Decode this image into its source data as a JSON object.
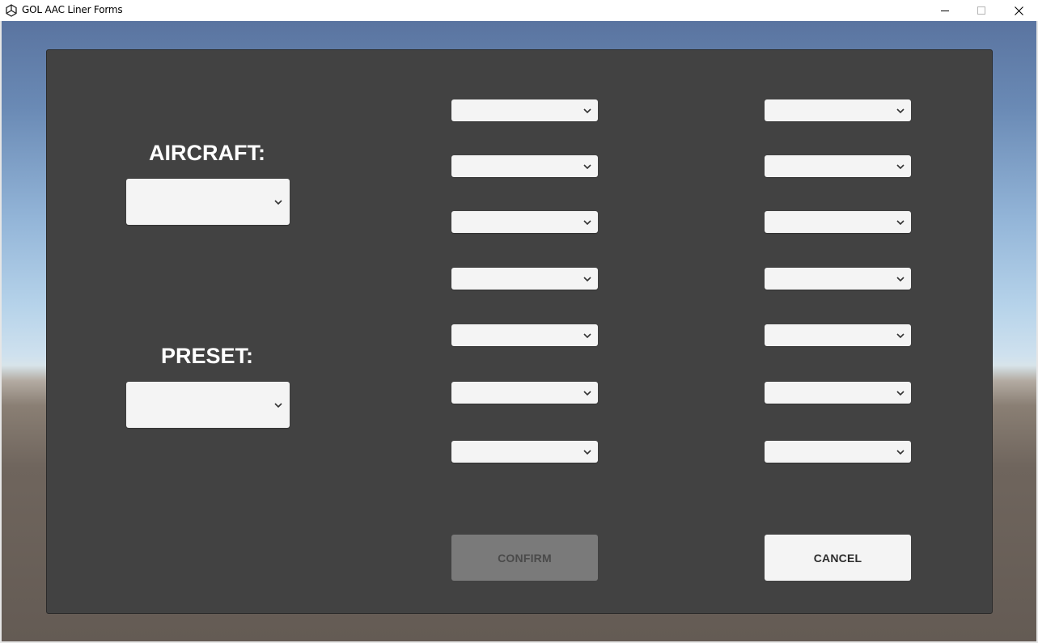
{
  "window": {
    "title": "GOL AAC Liner Forms",
    "icon": "unity-logo-icon",
    "controls": [
      "minimize-icon",
      "maximize-icon",
      "close-icon"
    ]
  },
  "form": {
    "aircraft_label": "AIRCRAFT:",
    "aircraft_value": "",
    "preset_label": "PRESET:",
    "preset_value": "",
    "column_a": [
      "",
      "",
      "",
      "",
      "",
      "",
      ""
    ],
    "column_b": [
      "",
      "",
      "",
      "",
      "",
      "",
      ""
    ],
    "confirm_label": "CONFIRM",
    "cancel_label": "CANCEL",
    "confirm_enabled": false
  },
  "colors": {
    "panel": "#424242",
    "dropdown": "#f4f4f4",
    "confirm_disabled": "#7a7a7a"
  }
}
